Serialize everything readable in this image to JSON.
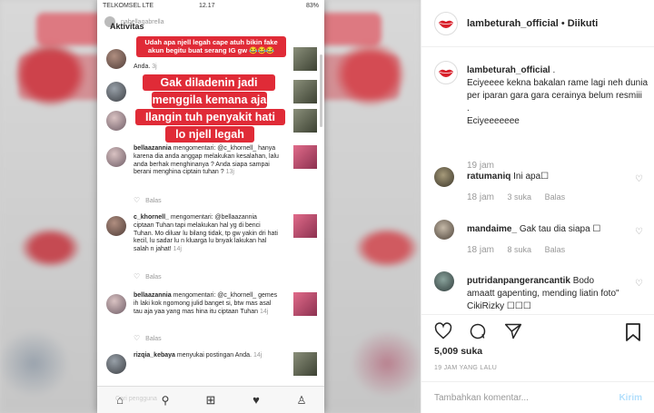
{
  "media": {
    "phone": {
      "status": {
        "carrier": "TELKOMSEL LTE",
        "clock": "12.17",
        "battery": "83%"
      },
      "header": {
        "account": "nabellagabrella",
        "section_title": "Aktivitas"
      },
      "red_captions": [
        "Udah apa njell legah cape atuh bikin fake akun begitu buat serang IG gw 😂😂😂",
        "Gak diladenin jadi",
        "menggila kemana aja",
        "Ilangin tuh penyakit hati",
        "lo njell legah"
      ],
      "activity": [
        {
          "text": "Anda.",
          "time": "3j"
        },
        {
          "text": "",
          "time": ""
        },
        {
          "user": "bellaazannia",
          "verb": "mengomentari:",
          "text": "@c_khornell_ hanya karena dia anda anggap melakukan kesalahan, lalu anda berhak menghinanya ? Anda siapa sampai berani menghina ciptain tuhan ?",
          "time": "13j",
          "reply": "Balas"
        },
        {
          "user": "c_khornell_",
          "verb": "mengomentari:",
          "text": "@bellaazannia ciptaan Tuhan tapi melakukan hal yg di benci Tuhan. Mo diluar lu bilang tidak, tp gw yakin dri hati kecil, lu sadar lu n kluarga lu bnyak lakukan hal salah n jahat!",
          "time": "14j",
          "reply": "Balas"
        },
        {
          "user": "bellaazannia",
          "verb": "mengomentari:",
          "text": "@c_khornell_ gemes ih laki kok ngomong julid banget si, btw mas asal tau aja yaa yang mas hina itu ciptaan Tuhan",
          "time": "14j",
          "reply": "Balas"
        },
        {
          "user": "rizqia_kebaya",
          "verb": "menyukai postingan",
          "text": "Anda.",
          "time": "14j"
        }
      ],
      "tabbar_placeholder": "Cari pengguna"
    }
  },
  "post": {
    "header": {
      "username": "lambeturah_official",
      "separator": "•",
      "follow_status": "Diikuti"
    },
    "caption": {
      "username": "lambeturah_official",
      "text_after_user": ".",
      "lines": [
        "Eciyeeee kekna bakalan rame lagi neh dunia per iparan gara gara cerainya belum resmiii",
        ".",
        "Eciyeeeeeee"
      ],
      "time": "19 jam"
    },
    "comments": [
      {
        "username": "ratumaniq",
        "text": "Ini apa☐",
        "time": "18 jam",
        "likes": "3 suka",
        "reply": "Balas"
      },
      {
        "username": "mandaime_",
        "text": "Gak tau dia siapa ☐",
        "time": "18 jam",
        "likes": "8 suka",
        "reply": "Balas"
      },
      {
        "username": "putridanpangerancantik",
        "text": "Bodo amaatt gapenting, mending liatin foto\" CikiRizky ☐☐☐",
        "time": "",
        "likes": "",
        "reply": ""
      }
    ],
    "likes_count": "5,009",
    "likes_word": "suka",
    "posted_ago": "19 JAM YANG LALU",
    "add_comment": {
      "placeholder": "Tambahkan komentar...",
      "submit": "Kirim"
    }
  },
  "colors": {
    "accent_red": "#e02b37",
    "link_blue_disabled": "#b2dffc",
    "muted": "#999999"
  },
  "icons": [
    "lips-logo-icon",
    "heart-icon",
    "comment-icon",
    "share-icon",
    "bookmark-icon",
    "home-icon",
    "search-icon",
    "add-icon",
    "activity-heart-icon",
    "profile-icon"
  ]
}
